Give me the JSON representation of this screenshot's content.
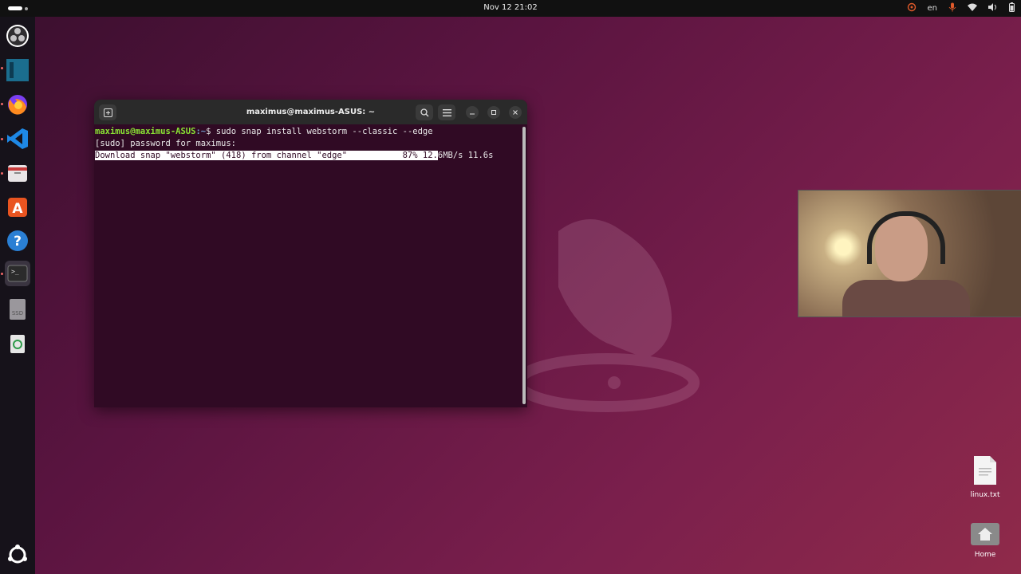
{
  "topbar": {
    "clock": "Nov 12  21:02",
    "language": "en"
  },
  "dock": {
    "items": [
      "obs-studio",
      "jetbrains-toolbox",
      "firefox",
      "vs-code",
      "files",
      "app-center",
      "help",
      "terminal",
      "ssd-drive",
      "trash",
      "show-apps"
    ],
    "ssd_label": "SSD"
  },
  "terminal": {
    "title": "maximus@maximus-ASUS: ~",
    "prompt_user": "maximus@maximus-ASUS",
    "prompt_path": ":~",
    "prompt_symbol": "$ ",
    "command": "sudo snap install webstorm --classic --edge",
    "line2": "[sudo] password for maximus:",
    "download_left": "Download snap \"webstorm\" (418) from channel \"edge\"",
    "download_hl_tail": "           87% 12.",
    "download_rest": "6MB/s 11.6s",
    "progress_percent": 87
  },
  "desktop": {
    "file_label": "linux.txt",
    "home_label": "Home"
  },
  "colors": {
    "terminal_bg": "#300a24",
    "prompt_green": "#8ae234",
    "prompt_blue": "#729fcf"
  }
}
